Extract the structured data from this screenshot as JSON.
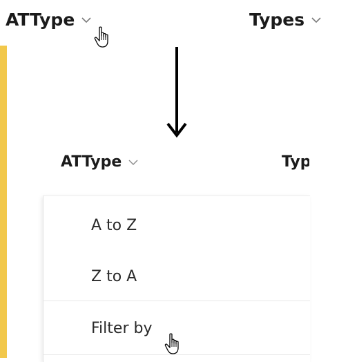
{
  "top_header": {
    "column_1": "ATType",
    "column_2": "Types"
  },
  "inner_header": {
    "column_1": "ATType",
    "column_2": "Types"
  },
  "sort_menu": {
    "items": [
      {
        "label": "A to Z"
      },
      {
        "label": "Z to A"
      },
      {
        "label": "Filter by"
      }
    ]
  },
  "icons": {
    "chevron": "chevron-down-icon",
    "cursor": "hand-pointer-icon",
    "arrow": "arrow-down-icon"
  },
  "colors": {
    "accent_bar": "#f2c84b",
    "text": "#1b1b1b",
    "chevron": "#7a7a7a"
  }
}
